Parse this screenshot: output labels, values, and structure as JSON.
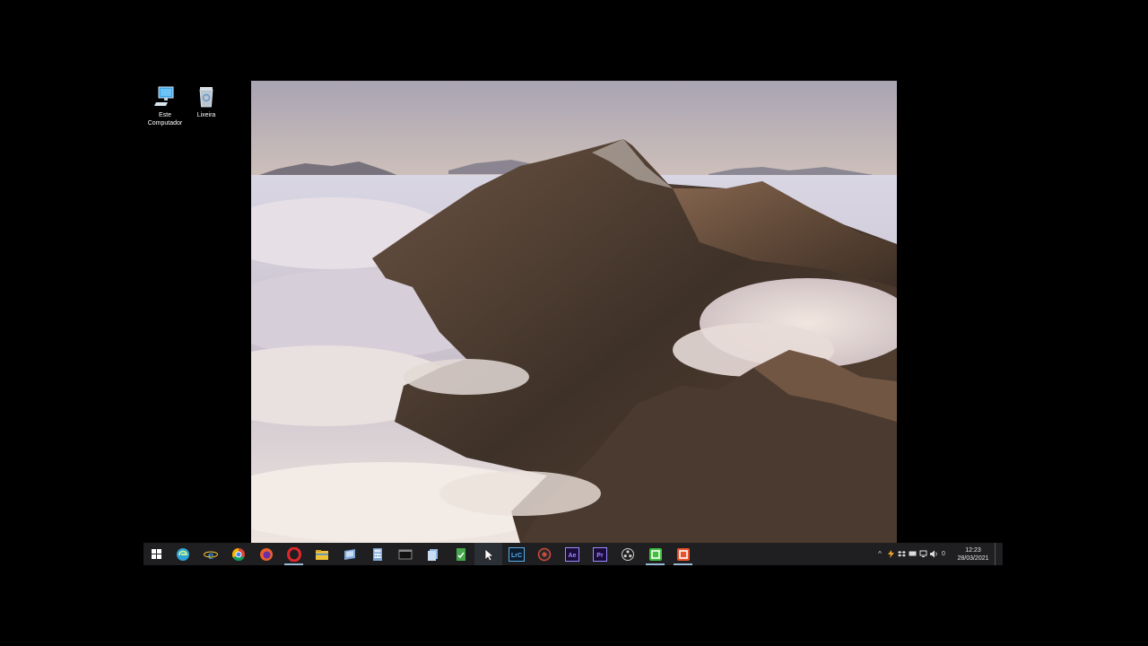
{
  "desktop_icons": [
    {
      "label_line1": "Este",
      "label_line2": "Computador",
      "icon": "computer-icon"
    },
    {
      "label_line1": "Lixeira",
      "label_line2": "",
      "icon": "recycle-bin-icon"
    }
  ],
  "taskbar": {
    "start_icon": "windows-start-icon",
    "apps": [
      {
        "name": "edge",
        "icon": "edge-icon",
        "color": "#2ea4d6"
      },
      {
        "name": "internet-explorer",
        "icon": "ie-icon",
        "color": "#3b8ed8"
      },
      {
        "name": "chrome",
        "icon": "chrome-icon",
        "color": "#e8b41d"
      },
      {
        "name": "firefox",
        "icon": "firefox-icon",
        "color": "#e8612d"
      },
      {
        "name": "opera",
        "icon": "opera-icon",
        "color": "#e0262d"
      },
      {
        "name": "file-explorer",
        "icon": "folder-icon",
        "color": "#f0c23a"
      },
      {
        "name": "app-blue",
        "icon": "window-icon",
        "color": "#7ea6d8"
      },
      {
        "name": "calculator",
        "icon": "calculator-icon",
        "color": "#7fa7d6"
      },
      {
        "name": "terminal",
        "icon": "terminal-icon",
        "color": "#888888"
      },
      {
        "name": "app-files",
        "icon": "files-icon",
        "color": "#8fb8e6"
      },
      {
        "name": "app-green",
        "icon": "green-doc-icon",
        "color": "#46a84a"
      },
      {
        "name": "cursor-app",
        "icon": "cursor-icon",
        "color": "#cfd8e6"
      },
      {
        "name": "lrc",
        "icon": "lrc-icon",
        "label": "LrC",
        "color": "#5aaee8"
      },
      {
        "name": "davinci",
        "icon": "davinci-icon",
        "color": "#d34a3a"
      },
      {
        "name": "after-effects",
        "icon": "after-effects-icon",
        "label": "Ae",
        "color": "#9a8cff"
      },
      {
        "name": "premiere",
        "icon": "premiere-icon",
        "label": "Pr",
        "color": "#9a8cff"
      },
      {
        "name": "obs",
        "icon": "obs-icon",
        "color": "#cccccc"
      },
      {
        "name": "camtasia-green",
        "icon": "camtasia-icon",
        "color": "#3fbf3a"
      },
      {
        "name": "camtasia-recorder",
        "icon": "recorder-icon",
        "color": "#e8532d"
      }
    ],
    "tray": {
      "chevron": "^",
      "badge_number": "0",
      "time": "12:23",
      "date": "28/03/2021"
    }
  }
}
